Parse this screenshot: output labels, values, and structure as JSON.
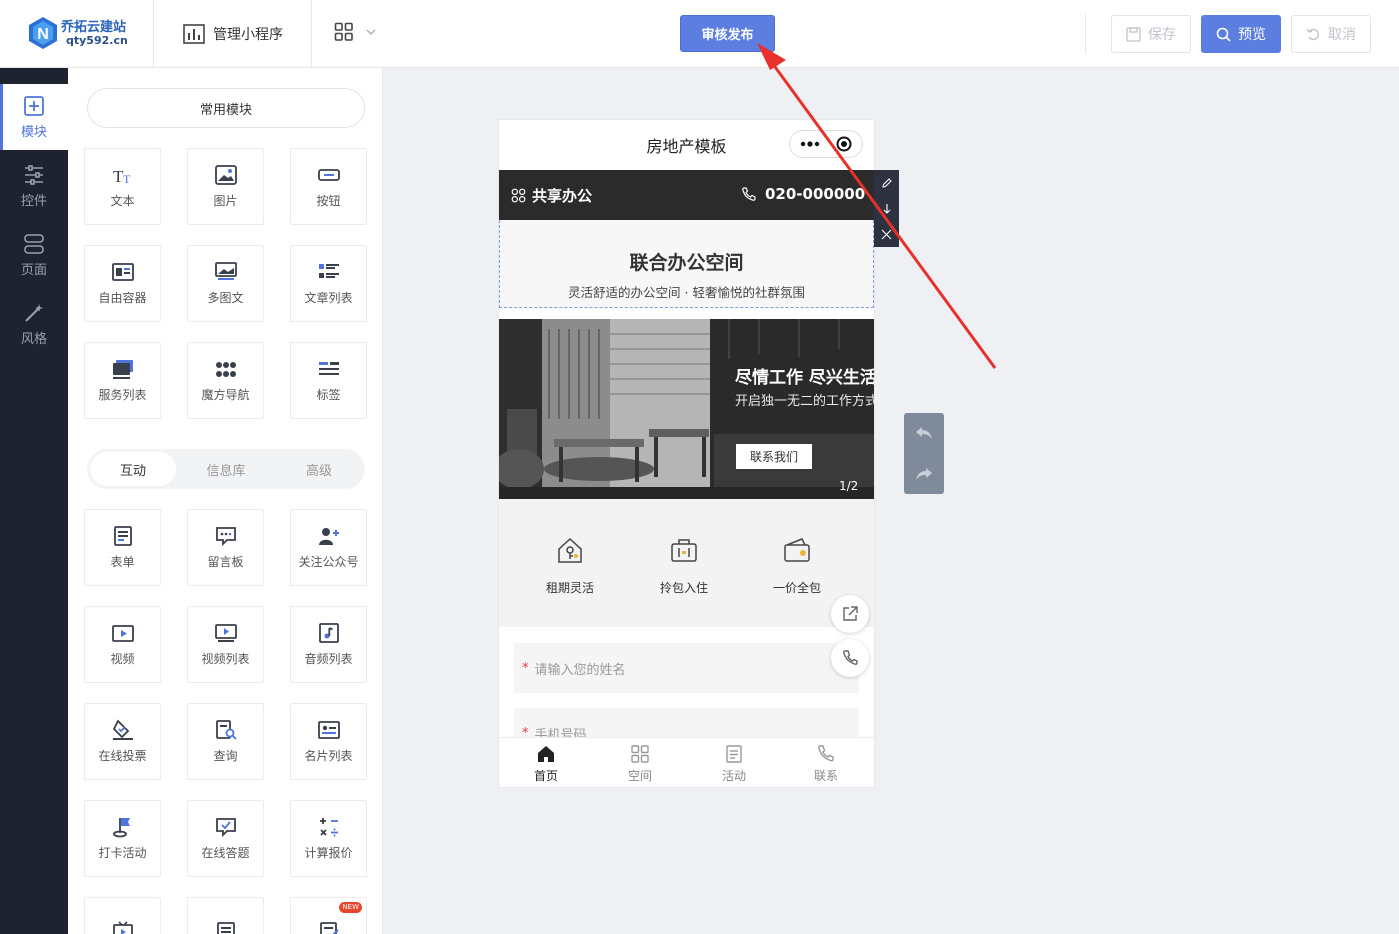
{
  "logo": {
    "name": "乔拓云建站",
    "url": "qty592.cn"
  },
  "topbar": {
    "manage_label": "管理小程序",
    "publish_label": "审核发布",
    "save_label": "保存",
    "preview_label": "预览",
    "cancel_label": "取消"
  },
  "leftnav": {
    "items": [
      {
        "label": "模块",
        "icon": "plus-square-icon"
      },
      {
        "label": "控件",
        "icon": "sliders-icon"
      },
      {
        "label": "页面",
        "icon": "pages-icon"
      },
      {
        "label": "风格",
        "icon": "magic-wand-icon"
      }
    ]
  },
  "panel": {
    "common_label": "常用模块",
    "common_modules": [
      "文本",
      "图片",
      "按钮",
      "自由容器",
      "多图文",
      "文章列表",
      "服务列表",
      "魔方导航",
      "标签"
    ],
    "tabs": [
      "互动",
      "信息库",
      "高级"
    ],
    "interactive_modules": [
      "表单",
      "留言板",
      "关注公众号",
      "视频",
      "视频列表",
      "音频列表",
      "在线投票",
      "查询",
      "名片列表",
      "打卡活动",
      "在线答题",
      "计算报价"
    ],
    "new_badge": "NEW"
  },
  "phone": {
    "title": "房地产模板",
    "header_left": "共享办公",
    "header_phone": "020-000000",
    "hero_title": "联合办公空间",
    "hero_sub": "灵活舒适的办公空间 · 轻奢愉悦的社群氛围",
    "banner_title": "尽情工作 尽兴生活",
    "banner_sub": "开启独一无二的工作方式",
    "banner_button": "联系我们",
    "banner_page": "1/2",
    "features": [
      "租期灵活",
      "拎包入住",
      "一价全包"
    ],
    "form_name_placeholder": "请输入您的姓名",
    "form_phone_placeholder": "手机号码",
    "form_required": "*",
    "tabbar": [
      "首页",
      "空间",
      "活动",
      "联系"
    ]
  },
  "colors": {
    "accent": "#5b7ee0",
    "nav_bg": "#1f2330",
    "annotation_arrow": "#e8312a"
  }
}
